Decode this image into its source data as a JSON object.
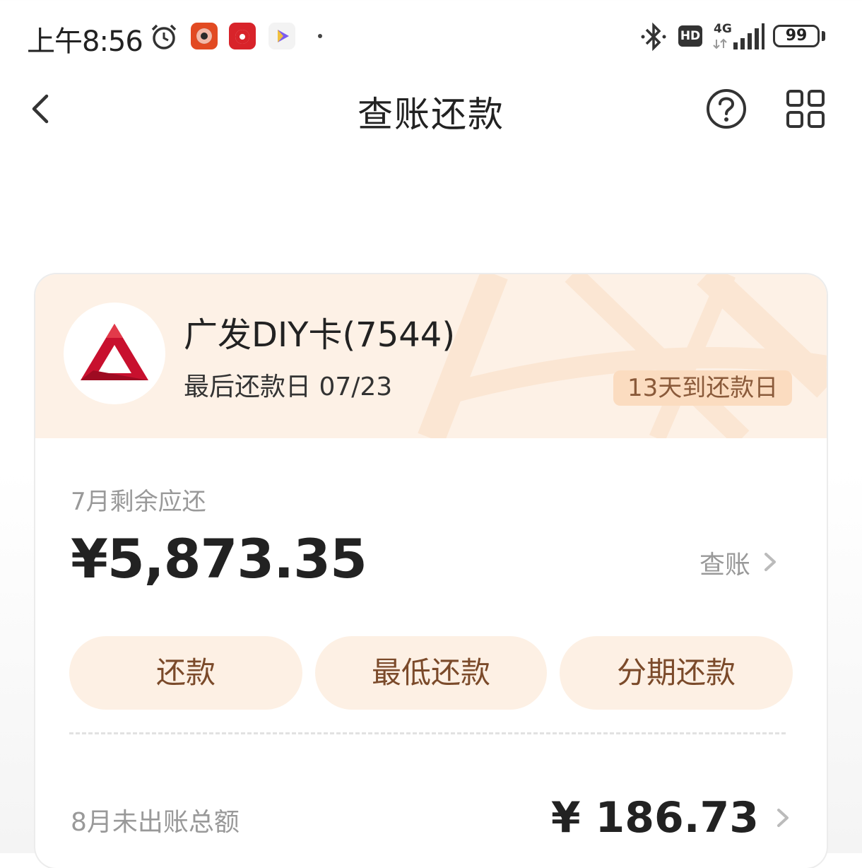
{
  "status_bar": {
    "time": "上午8:56",
    "battery": "99",
    "network": "4G",
    "hd": "HD",
    "icons": [
      "alarm-icon",
      "music-app-icon",
      "red-app-icon",
      "video-app-icon",
      "bluetooth-icon",
      "hd-icon",
      "signal-icon",
      "battery-icon"
    ]
  },
  "header": {
    "title": "查账还款",
    "back_icon": "chevron-left-icon",
    "help_icon": "question-circle-icon",
    "menu_icon": "grid-icon"
  },
  "card": {
    "bank_name": "广发DIY卡(7544)",
    "due_date_label": "最后还款日 07/23",
    "days_badge": "13天到还款日",
    "logo": "bank-logo-icon",
    "brand_color": "#c8102e"
  },
  "statement": {
    "label": "7月剩余应还",
    "amount": "¥5,873.35",
    "check_label": "查账"
  },
  "actions": {
    "repay": "还款",
    "min_repay": "最低还款",
    "installment": "分期还款"
  },
  "unbilled": {
    "label": "8月未出账总额",
    "amount": "¥ 186.73"
  },
  "colors": {
    "button_bg": "#fdf0e4",
    "button_text": "#7b4a2a",
    "header_bg": "#fdf1e6",
    "badge_bg": "#fbdcc0"
  }
}
